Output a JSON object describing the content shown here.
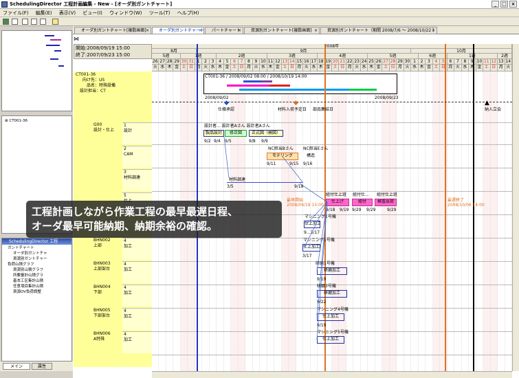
{
  "window": {
    "title": "SchedulingDirector 工程計画編集 - New - [オーダ別ガントチャート]",
    "minimize": "_",
    "maximize": "□",
    "close": "×"
  },
  "menu": [
    "ファイル(F)",
    "編集(E)",
    "表示(V)",
    "ビュー(I)",
    "ウィンドウ(W)",
    "ツール(T)",
    "ヘルプ(H)"
  ],
  "tabs": [
    {
      "label": "オーダ別ガントチャート[複数画面]"
    },
    {
      "label": "オーダ別ガントチャート"
    },
    {
      "label": "パートチャート"
    },
    {
      "label": "資源別ガントチャート[複数画面]"
    },
    {
      "label": "資源別ガントチャート（期間 2008/7/6 ～ 2008/10/22 ）"
    }
  ],
  "dates": {
    "start": "開始:2008/09/19 15:00",
    "end": "終了:2007/09/23 15:00"
  },
  "calendar": {
    "year": "2008年",
    "months": [
      "8月",
      "9月",
      "10月"
    ],
    "weeks": [
      "5週",
      "1週",
      "2週",
      "3週",
      "4週",
      "5週",
      "6週",
      "1週",
      "2週"
    ],
    "days": [
      "26",
      "27",
      "28",
      "29",
      "30",
      "31",
      "1",
      "2",
      "3",
      "4",
      "5",
      "6",
      "7",
      "8",
      "9",
      "10",
      "11",
      "12",
      "13",
      "14",
      "15",
      "16",
      "17",
      "18",
      "19",
      "20",
      "21",
      "22",
      "23",
      "24",
      "25",
      "26",
      "27",
      "28",
      "29",
      "30",
      "1",
      "2",
      "3",
      "4",
      "5",
      "6",
      "7",
      "8",
      "9",
      "10",
      "11",
      "12",
      "13",
      "14"
    ],
    "weekdays": [
      "火",
      "水",
      "木",
      "金",
      "土",
      "日",
      "月",
      "火",
      "水",
      "木",
      "金",
      "土",
      "日",
      "月",
      "火",
      "水",
      "木",
      "金",
      "土",
      "日",
      "月",
      "火",
      "水",
      "木",
      "金",
      "土",
      "日",
      "月",
      "火",
      "水",
      "木",
      "金",
      "土",
      "日",
      "月",
      "火",
      "水",
      "木",
      "金",
      "土",
      "日",
      "月",
      "火",
      "水",
      "木",
      "金",
      "土",
      "日",
      "月",
      "火"
    ]
  },
  "order": {
    "id": "CT001-36",
    "dest": "向け先：US",
    "product": "品名：特殊設備",
    "owner": "設計担当：CT",
    "bar_label": "CT001-36 / 2008/09/02 08:00 / 2008/10/19 14:00",
    "start_tag": "2008/09/02",
    "end_tag": "2008/09/23"
  },
  "milestones": {
    "spec": "仕様承認",
    "material": "材料入荷予定日",
    "parts": "部品集結日",
    "delivery": "納入立会",
    "schedule_line": "予定",
    "earliest": "最早開始",
    "earliest_date": "2008/09/19 15:00",
    "latest": "最遅終了",
    "latest_date": "2008/10/06 14:00"
  },
  "rows": [
    {
      "code": "G00",
      "name": "設計・仕上",
      "sub": "1\n設計"
    },
    {
      "code": "",
      "name": "",
      "sub": "2\nCAM"
    },
    {
      "code": "",
      "name": "",
      "sub": "3\n材料調達"
    },
    {
      "code": "",
      "name": "",
      "sub": "5\n仕上"
    },
    {
      "code": "BHN002",
      "name": "上部",
      "sub": "4\n加工"
    },
    {
      "code": "BHN003",
      "name": "上部架台",
      "sub": "4\n加工"
    },
    {
      "code": "BHN004",
      "name": "下部",
      "sub": "4\n加工"
    },
    {
      "code": "BHN005",
      "name": "下部架台",
      "sub": "4\n加工"
    },
    {
      "code": "BHN006",
      "name": "A特殊",
      "sub": "4\n加工"
    }
  ],
  "tasks": {
    "design_owner": "設計者... 設計者Aさん 設計者Aさん",
    "t1": "製品設計",
    "t2": "修正図",
    "t3": "正式図（検図）",
    "d1": "9/2",
    "d2": "9/4",
    "d3": "9/5",
    "d4": "9/8",
    "d5": "9/9",
    "nc_a": "NC担当Bさん",
    "nc_b": "NC担当Eさん",
    "cam": "モデリング",
    "cam2": "構造",
    "cam_d1": "9/11",
    "cam_d2": "9/15",
    "cam_d3": "9/16",
    "mat": "材料調達",
    "mat_d1": "3/5",
    "mat_d2": "9/18",
    "fin_a": "組付仕上班",
    "fin_b": "組付仕...",
    "fin_c": "組付仕上班",
    "fin1": "仕上げ",
    "fin2": "組付",
    "fin3": "検査出荷",
    "fin_d1": "9/18",
    "fin_d2": "9/19",
    "fin_d3": "9/29",
    "fin_d4": "9/29",
    "fin_d5": "9/29",
    "m1": "マシニング1号機",
    "m2": "マシニング1号機",
    "m3": "研磨1号機",
    "m4": "研磨3号機",
    "m5": "マシニング4号機",
    "m6": "マシニング5号機",
    "work1": "荒",
    "work2": "仕上加工",
    "work3": "研磨加工",
    "work4": "研磨加工",
    "work5": "仕上加工",
    "work6": "仕上加工",
    "wd1": "9...3/17",
    "wd2": "3/17",
    "wd3": "9/19",
    "wd4": "9/22",
    "wd5": "9/19"
  },
  "caption": {
    "line1": "工程計画しながら作業工程の最早最遅日程、",
    "line2": "オーダ最早可能納期、納期余裕の確認。"
  },
  "left_tree": {
    "item": "CT001-36"
  },
  "tree2": {
    "header": "SchedulingDirector 工程",
    "items": [
      "ガントチャート",
      "オーダ別ガントチャ",
      "資源別ガントチャー",
      "負荷山積グラフ",
      "資源別山積グラフ",
      "所要量計山積グラ",
      "基本工区集計山積",
      "任意項目集計山積",
      "資源OV負荷調整"
    ]
  },
  "bottom_tabs": [
    "メイン",
    "属性"
  ],
  "colors": {
    "accent": "#0033aa",
    "today": "#e07020",
    "pink": "#ff66cc",
    "blue_bar": "#3050d0"
  }
}
